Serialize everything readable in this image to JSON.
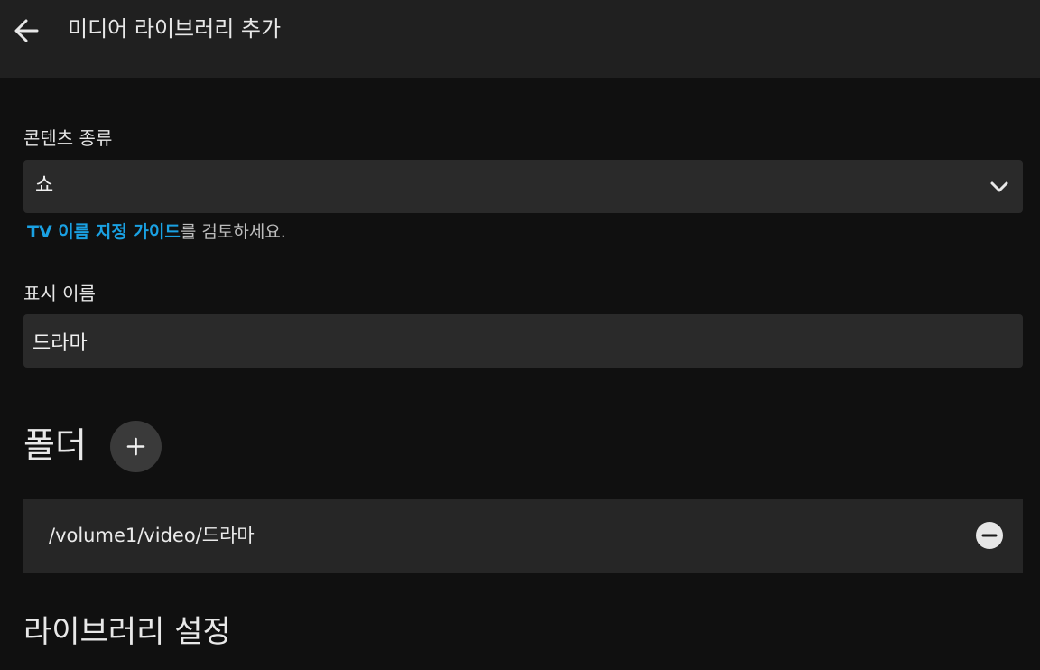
{
  "header": {
    "back_icon": "arrow-left-icon",
    "title": "미디어 라이브러리 추가"
  },
  "content_type": {
    "label": "콘텐츠 종류",
    "selected": "쇼",
    "dropdown_icon": "chevron-down-icon"
  },
  "help": {
    "link_text": "TV 이름 지정 가이드",
    "suffix": "를 검토하세요.",
    "link_color": "#1aa1e3"
  },
  "display_name": {
    "label": "표시 이름",
    "value": "드라마"
  },
  "folders": {
    "title": "폴더",
    "add_icon": "plus-icon",
    "items": [
      {
        "path": "/volume1/video/드라마",
        "remove_icon": "minus-circle-icon"
      }
    ]
  },
  "library_settings": {
    "title": "라이브러리 설정"
  }
}
